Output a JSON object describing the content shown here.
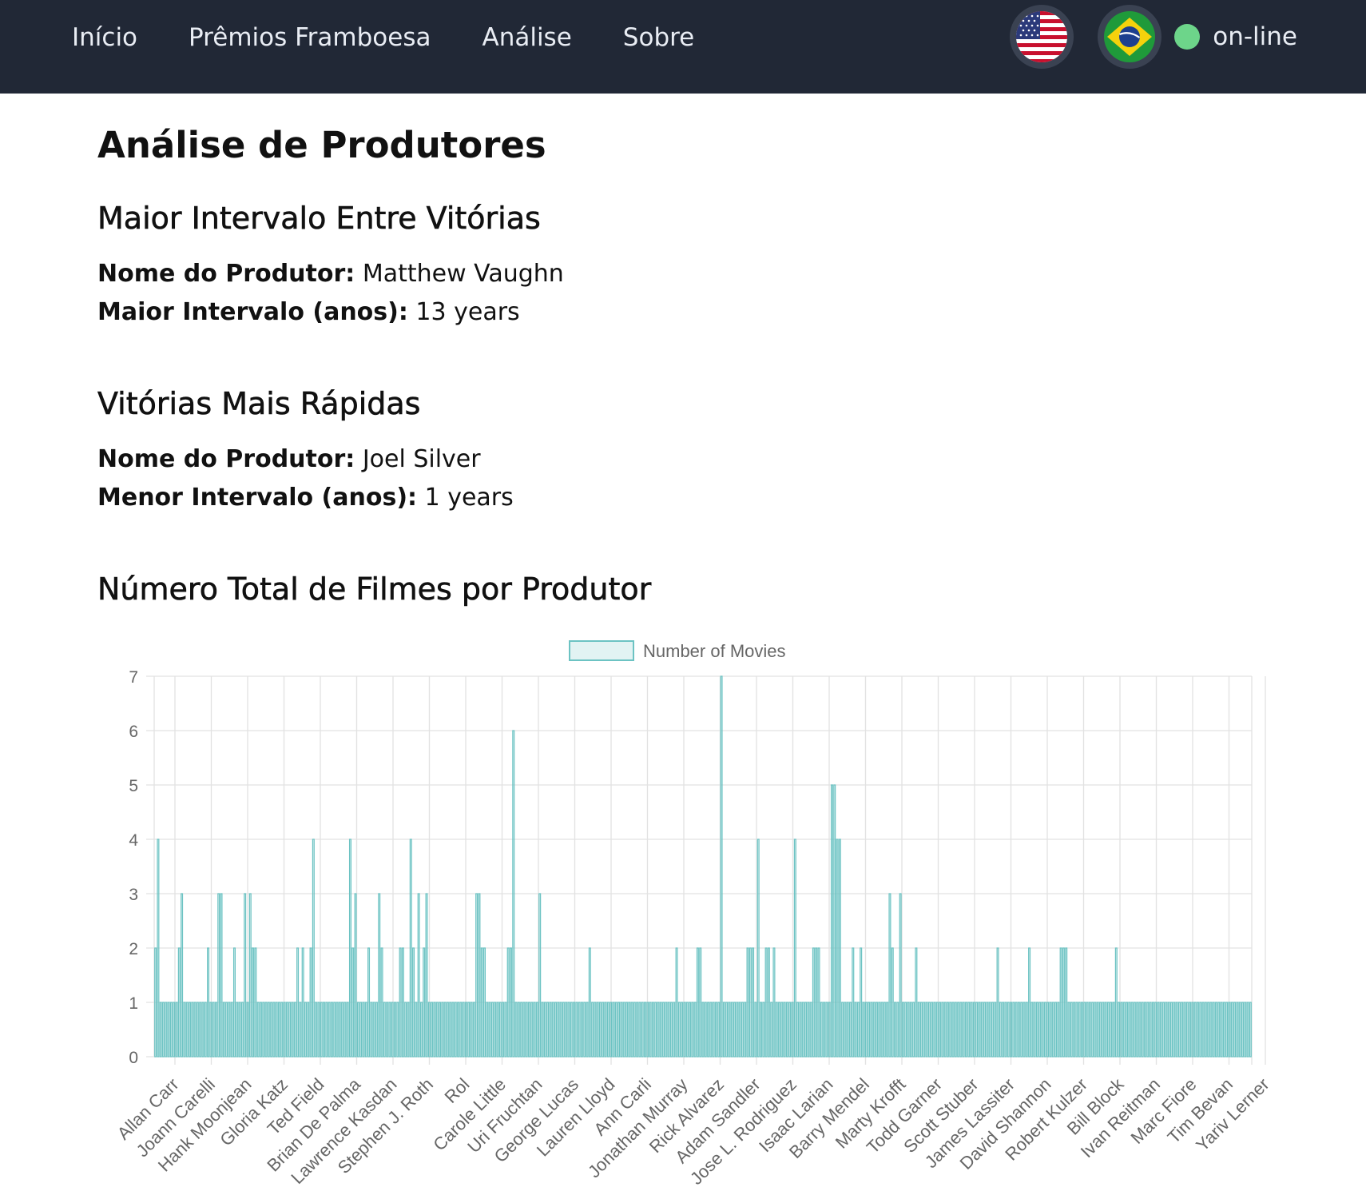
{
  "nav": {
    "links": [
      "Início",
      "Prêmios Framboesa",
      "Análise",
      "Sobre"
    ],
    "status": "on-line",
    "flags": [
      "us-flag-icon",
      "brazil-flag-icon"
    ],
    "status_color": "#6dd58a"
  },
  "page": {
    "title": "Análise de Produtores"
  },
  "max_interval": {
    "heading": "Maior Intervalo Entre Vitórias",
    "producer_label": "Nome do Produtor:",
    "producer": "Matthew Vaughn",
    "interval_label": "Maior Intervalo (anos):",
    "interval": "13 years"
  },
  "min_interval": {
    "heading": "Vitórias Mais Rápidas",
    "producer_label": "Nome do Produtor:",
    "producer": "Joel Silver",
    "interval_label": "Menor Intervalo (anos):",
    "interval": "1 years"
  },
  "chart_section": {
    "heading": "Número Total de Filmes por Produtor"
  },
  "chart_data": {
    "type": "bar",
    "series": [
      {
        "name": "Number of Movies",
        "color": "#6cc3c3"
      }
    ],
    "ylim": [
      0,
      7
    ],
    "yticks": [
      0,
      1,
      2,
      3,
      4,
      5,
      6,
      7
    ],
    "grid": true,
    "legend": "top-center",
    "tick_labels": [
      "Allan Carr",
      "Joann Carelli",
      "Hank Moonjean",
      "Gloria Katz",
      "Ted Field",
      "Brian De Palma",
      "Lawrence Kasdan",
      "Stephen J. Roth",
      "Rol",
      "Carole Little",
      "Uri Fruchtan",
      "George Lucas",
      "Lauren Lloyd",
      "Ann Carli",
      "Jonathan Murray",
      "Rick Alvarez",
      "Adam Sandler",
      "Jose L. Rodriguez",
      "Isaac Larian",
      "Barry Mendel",
      "Marty Krofft",
      "Todd Garner",
      "Scott Stuber",
      "James Lassiter",
      "David Shannon",
      "Robert Kulzer",
      "Bill Block",
      "Ivan Reitman",
      "Marc Fiore",
      "Tim Bevan",
      "Yariv Lerner"
    ],
    "values": [
      2,
      4,
      1,
      1,
      1,
      1,
      1,
      1,
      1,
      2,
      3,
      1,
      1,
      1,
      1,
      1,
      1,
      1,
      1,
      1,
      2,
      1,
      1,
      1,
      3,
      3,
      1,
      1,
      1,
      1,
      2,
      1,
      1,
      1,
      3,
      1,
      3,
      2,
      2,
      1,
      1,
      1,
      1,
      1,
      1,
      1,
      1,
      1,
      1,
      1,
      1,
      1,
      1,
      1,
      2,
      1,
      2,
      1,
      1,
      2,
      4,
      1,
      1,
      1,
      1,
      1,
      1,
      1,
      1,
      1,
      1,
      1,
      1,
      1,
      4,
      2,
      3,
      1,
      1,
      1,
      1,
      2,
      1,
      1,
      1,
      3,
      2,
      1,
      1,
      1,
      1,
      1,
      1,
      2,
      2,
      1,
      1,
      4,
      2,
      1,
      3,
      1,
      2,
      3,
      1,
      1,
      1,
      1,
      1,
      1,
      1,
      1,
      1,
      1,
      1,
      1,
      1,
      1,
      1,
      1,
      1,
      1,
      3,
      3,
      2,
      2,
      1,
      1,
      1,
      1,
      1,
      1,
      1,
      1,
      2,
      2,
      6,
      1,
      1,
      1,
      1,
      1,
      1,
      1,
      1,
      1,
      3,
      1,
      1,
      1,
      1,
      1,
      1,
      1,
      1,
      1,
      1,
      1,
      1,
      1,
      1,
      1,
      1,
      1,
      1,
      2,
      1,
      1,
      1,
      1,
      1,
      1,
      1,
      1,
      1,
      1,
      1,
      1,
      1,
      1,
      1,
      1,
      1,
      1,
      1,
      1,
      1,
      1,
      1,
      1,
      1,
      1,
      1,
      1,
      1,
      1,
      1,
      1,
      2,
      1,
      1,
      1,
      1,
      1,
      1,
      1,
      2,
      2,
      1,
      1,
      1,
      1,
      1,
      1,
      1,
      7,
      1,
      1,
      1,
      1,
      1,
      1,
      1,
      1,
      1,
      2,
      2,
      2,
      1,
      4,
      1,
      1,
      2,
      2,
      1,
      2,
      1,
      1,
      1,
      1,
      1,
      1,
      1,
      4,
      1,
      1,
      1,
      1,
      1,
      1,
      2,
      2,
      2,
      1,
      1,
      1,
      1,
      5,
      5,
      4,
      4,
      1,
      1,
      1,
      1,
      2,
      1,
      1,
      2,
      1,
      1,
      1,
      1,
      1,
      1,
      1,
      1,
      1,
      1,
      3,
      2,
      1,
      1,
      3,
      1,
      1,
      1,
      1,
      1,
      2,
      1,
      1,
      1,
      1,
      1,
      1,
      1,
      1,
      1,
      1,
      1,
      1,
      1,
      1,
      1,
      1,
      1,
      1,
      1,
      1,
      1,
      1,
      1,
      1,
      1,
      1,
      1,
      1,
      1,
      1,
      2,
      1,
      1,
      1,
      1,
      1,
      1,
      1,
      1,
      1,
      1,
      1,
      2,
      1,
      1,
      1,
      1,
      1,
      1,
      1,
      1,
      1,
      1,
      1,
      2,
      2,
      2,
      1,
      1,
      1,
      1,
      1,
      1,
      1,
      1,
      1,
      1,
      1,
      1,
      1,
      1,
      1,
      1,
      1,
      1,
      2,
      1,
      1,
      1,
      1,
      1,
      1,
      1,
      1,
      1,
      1,
      1,
      1,
      1,
      1,
      1,
      1,
      1,
      1,
      1,
      1,
      1,
      1,
      1,
      1,
      1,
      1,
      1,
      1,
      1,
      1,
      1,
      1,
      1,
      1,
      1,
      1,
      1,
      1,
      1,
      1,
      1,
      1,
      1,
      1,
      1,
      1,
      1,
      1,
      1,
      1,
      1
    ]
  }
}
